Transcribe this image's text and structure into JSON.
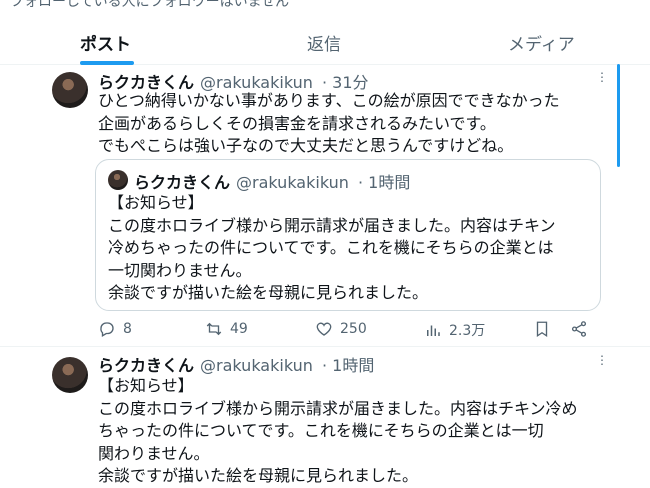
{
  "top_text": "フォローしている人にフォロワーはいません",
  "tabs": [
    {
      "label": "ポスト",
      "active": true
    },
    {
      "label": "返信",
      "active": false
    },
    {
      "label": "メディア",
      "active": false
    }
  ],
  "colors": {
    "accent": "#1d9bf0",
    "text": "#0f1419",
    "muted": "#536471",
    "border": "#cfd9de"
  },
  "post1": {
    "name": "らクカきくん",
    "handle": "@rakukakikun",
    "time": "· 31分",
    "lines": [
      "ひとつ納得いかない事があります、この絵が原因でできなかった",
      "企画があるらしくその損害金を請求されるみたいです。",
      "でもぺこらは強い子なので大丈夫だと思うんですけどね。"
    ],
    "quote": {
      "name": "らクカきくん",
      "handle": "@rakukakikun",
      "time": "· 1時間",
      "lines": [
        "【お知らせ】",
        "この度ホロライブ様から開示請求が届きました。内容はチキン",
        "冷めちゃったの件についてです。これを機にそちらの企業とは",
        "一切関わりません。",
        "余談ですが描いた絵を母親に見られました。"
      ]
    },
    "actions": {
      "replies": "8",
      "reposts": "49",
      "likes": "250",
      "views": "2.3万"
    }
  },
  "post2": {
    "name": "らクカきくん",
    "handle": "@rakukakikun",
    "time": "· 1時間",
    "lines": [
      "【お知らせ】",
      "この度ホロライブ様から開示請求が届きました。内容はチキン冷め",
      "ちゃったの件についてです。これを機にそちらの企業とは一切",
      "関わりません。",
      "余談ですが描いた絵を母親に見られました。"
    ]
  }
}
